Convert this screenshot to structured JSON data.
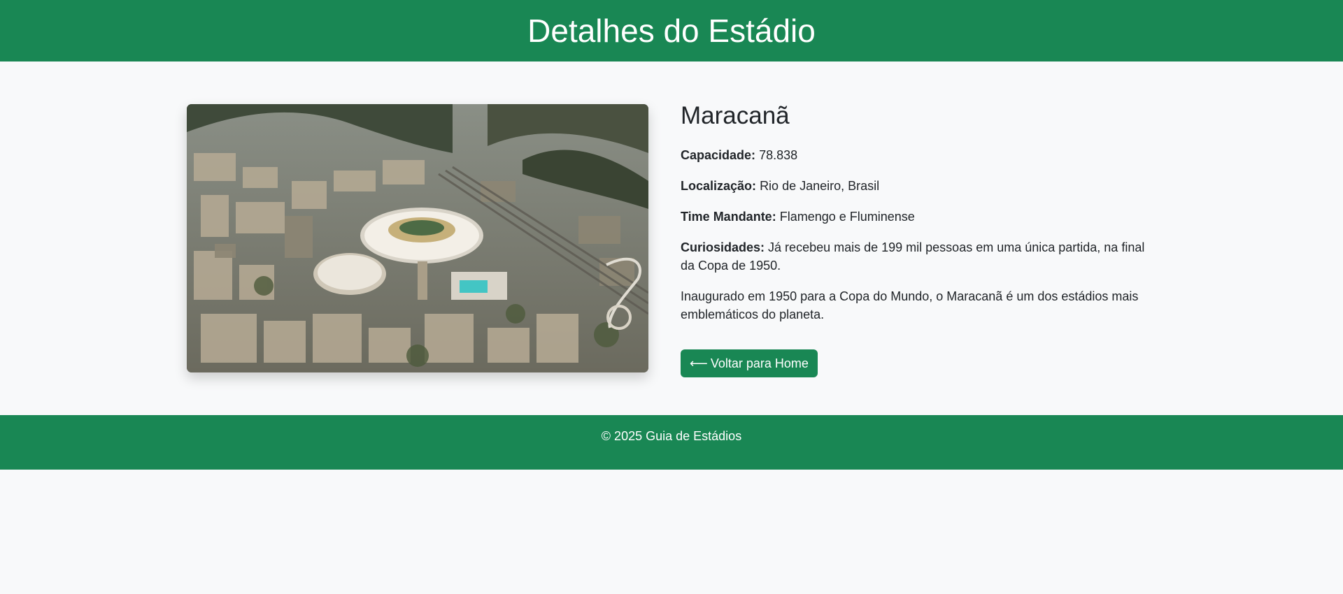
{
  "header": {
    "title": "Detalhes do Estádio"
  },
  "stadium": {
    "name": "Maracanã",
    "image_alt": "Vista aérea do Maracanã",
    "fields": [
      {
        "label": "Capacidade:",
        "value": "78.838"
      },
      {
        "label": "Localização:",
        "value": "Rio de Janeiro, Brasil"
      },
      {
        "label": "Time Mandante:",
        "value": "Flamengo e Fluminense"
      },
      {
        "label": "Curiosidades:",
        "value": "Já recebeu mais de 199 mil pessoas em uma única partida, na final da Copa de 1950."
      }
    ],
    "description": "Inaugurado em 1950 para a Copa do Mundo, o Maracanã é um dos estádios mais emblemáticos do planeta."
  },
  "back_button": {
    "arrow": "⟵",
    "label": "Voltar para Home",
    "icon": "arrow-left-icon"
  },
  "footer": {
    "text": "© 2025 Guia de Estádios"
  },
  "colors": {
    "brand_green": "#198754",
    "background": "#f8f9fa",
    "text": "#212529"
  }
}
